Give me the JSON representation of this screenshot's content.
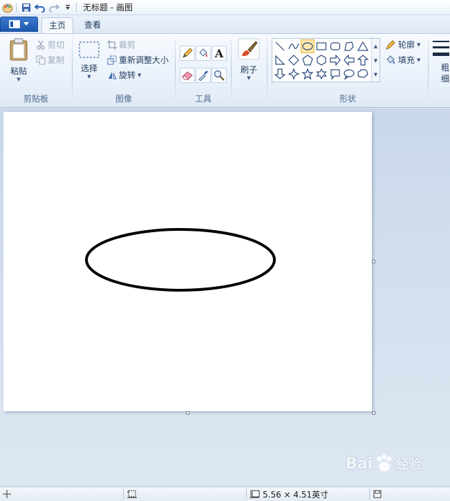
{
  "window": {
    "title": "无标题 - 画图"
  },
  "tabs": [
    {
      "label": "主页",
      "active": true
    },
    {
      "label": "查看",
      "active": false
    }
  ],
  "ribbon": {
    "clipboard": {
      "group_label": "剪贴板",
      "paste": "粘贴",
      "cut": "剪切",
      "copy": "复制"
    },
    "image": {
      "group_label": "图像",
      "select": "选择",
      "crop": "裁剪",
      "resize": "重新调整大小",
      "rotate": "旋转"
    },
    "tools": {
      "group_label": "工具",
      "text_tool_glyph": "A"
    },
    "brushes": {
      "label": "刷子"
    },
    "shapes": {
      "group_label": "形状",
      "outline": "轮廓",
      "fill": "填充",
      "selected_shape": "oval"
    },
    "size": {
      "label_line1": "粗",
      "label_line2": "细"
    }
  },
  "statusbar": {
    "canvas_size": "5.56 × 4.51英寸"
  },
  "watermark": {
    "text": "Bai",
    "text2": "经验"
  },
  "colors": {
    "accent": "#1c57b0",
    "selected_shape_bg": "#fde7a8",
    "canvas": "#ffffff",
    "stroke": "#000000"
  }
}
